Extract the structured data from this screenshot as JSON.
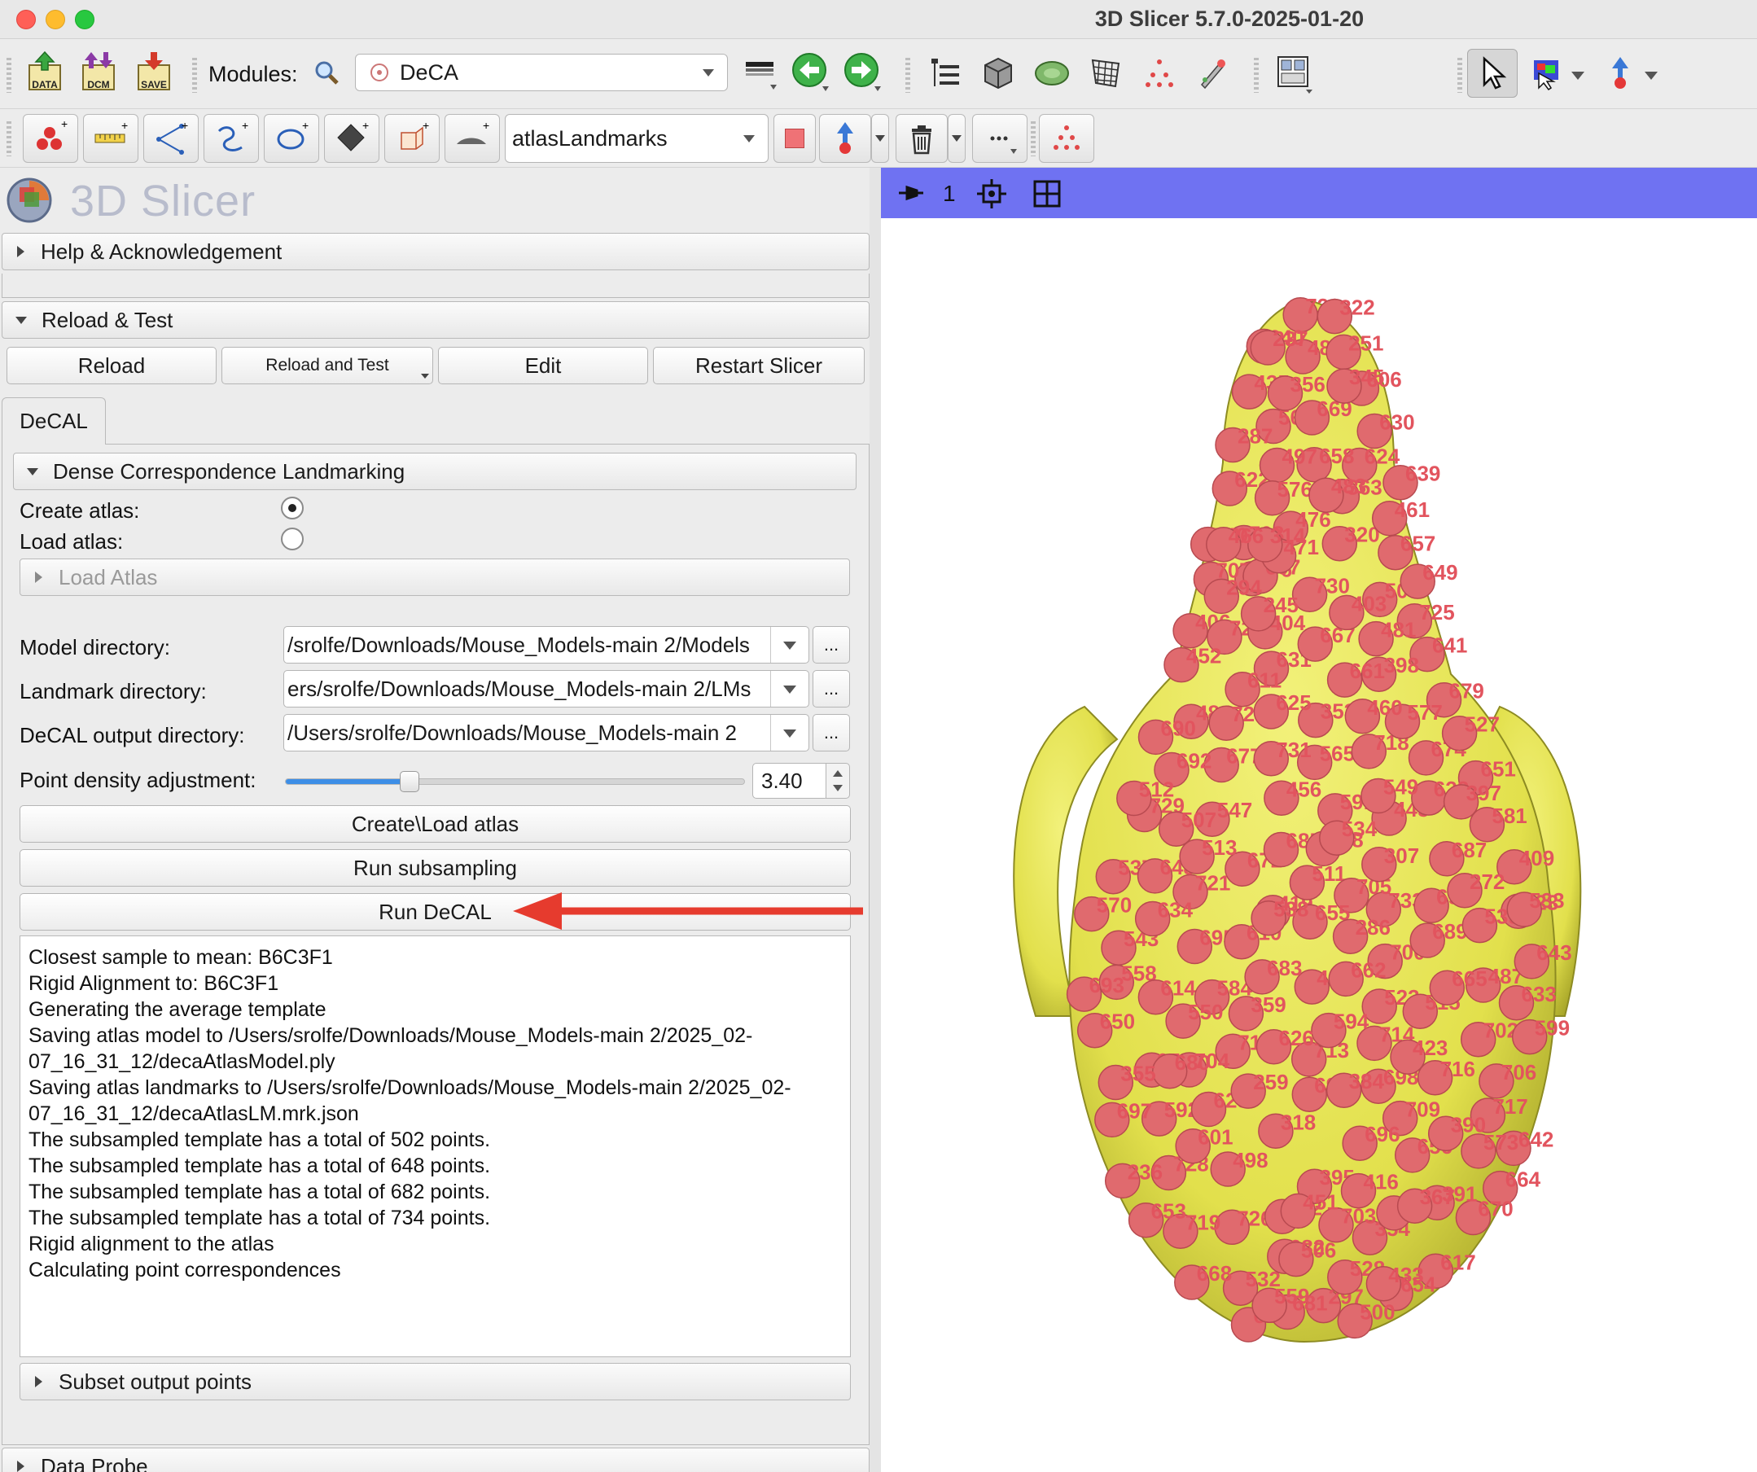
{
  "window": {
    "title": "3D Slicer 5.7.0-2025-01-20"
  },
  "toolbar": {
    "data_label": "DATA",
    "dcm_label": "DCM",
    "save_label": "SAVE",
    "modules_label": "Modules:",
    "module_selected": "DeCA",
    "markup_node": "atlasLandmarks"
  },
  "panel": {
    "logo_text": "3D Slicer",
    "help_section": "Help & Acknowledgement",
    "reload_section": "Reload & Test",
    "reload_button": "Reload",
    "reload_test_button": "Reload and Test",
    "edit_button": "Edit",
    "restart_button": "Restart Slicer",
    "tab_label": "DeCAL",
    "dense_section": "Dense Correspondence Landmarking",
    "create_atlas_label": "Create atlas:",
    "load_atlas_label": "Load atlas:",
    "load_atlas_section": "Load Atlas",
    "model_dir_label": "Model directory:",
    "model_dir_value": "/srolfe/Downloads/Mouse_Models-main 2/Models",
    "landmark_dir_label": "Landmark directory:",
    "landmark_dir_value": "ers/srolfe/Downloads/Mouse_Models-main 2/LMs",
    "output_dir_label": "DeCAL output directory:",
    "output_dir_value": "/Users/srolfe/Downloads/Mouse_Models-main 2",
    "dots": "...",
    "density_label": "Point density adjustment:",
    "density_value": "3.40",
    "density_fraction": 0.27,
    "create_load_button": "Create\\Load atlas",
    "subsampling_button": "Run subsampling",
    "run_decal_button": "Run DeCAL",
    "log_lines": [
      "Closest sample to mean: B6C3F1",
      "Rigid Alignment to: B6C3F1",
      "Generating the average template",
      "Saving atlas model to /Users/srolfe/Downloads/Mouse_Models-main 2/2025_02-07_16_31_12/decaAtlasModel.ply",
      "Saving atlas landmarks to /Users/srolfe/Downloads/Mouse_Models-main 2/2025_02-07_16_31_12/decaAtlasLM.mrk.json",
      "The subsampled template has a total of 502 points.",
      "The subsampled template has a total of 648 points.",
      "The subsampled template has a total of 682 points.",
      "The subsampled template has a total of 734 points.",
      "Rigid alignment to the atlas",
      "Calculating point correspondences"
    ],
    "subset_section": "Subset output points",
    "data_probe_section": "Data Probe"
  },
  "viewer": {
    "view_number": "1",
    "landmark_labels": [
      "591",
      "568",
      "565",
      "606",
      "419",
      "503",
      "558",
      "547",
      "614",
      "511",
      "622",
      "617",
      "532",
      "584",
      "639",
      "677",
      "672",
      "624",
      "631",
      "657",
      "698",
      "692",
      "480",
      "523",
      "674",
      "676",
      "675",
      "664",
      "537",
      "476",
      "515",
      "649",
      "722",
      "726",
      "487",
      "435",
      "687",
      "728",
      "729",
      "730",
      "592",
      "543",
      "484",
      "456",
      "322",
      "641",
      "714",
      "731",
      "685",
      "630",
      "492",
      "354",
      "651",
      "342",
      "445",
      "717",
      "409",
      "297",
      "683",
      "716",
      "315",
      "406",
      "363",
      "725",
      "703",
      "353",
      "719",
      "724",
      "236",
      "713",
      "320",
      "670",
      "679",
      "318",
      "723",
      "720",
      "709",
      "656",
      "678",
      "706",
      "696",
      "721",
      "733",
      "718",
      "654",
      "634",
      "398",
      "625",
      "669",
      "715",
      "705",
      "695",
      "287",
      "650",
      "694",
      "708",
      "668",
      "404",
      "251",
      "615",
      "667",
      "700",
      "702",
      "707",
      "693",
      "259",
      "570",
      "643",
      "395",
      "498",
      "594",
      "682",
      "697",
      "699",
      "611",
      "391",
      "452",
      "628",
      "658",
      "681",
      "704",
      "690",
      "559",
      "680",
      "689",
      "662",
      "640",
      "403",
      "500",
      "607",
      "642",
      "661",
      "655",
      "599",
      "540",
      "539",
      "665",
      "653",
      "633",
      "356",
      "573",
      "648",
      "626",
      "581",
      "497",
      "528",
      "359",
      "507",
      "625",
      "610",
      "423",
      "601",
      "286",
      "533",
      "576",
      "577",
      "534",
      "461",
      "245",
      "384",
      "460",
      "550",
      "527",
      "483",
      "513",
      "538",
      "390",
      "433",
      "307",
      "237",
      "397",
      "549",
      "512",
      "471",
      "506",
      "451",
      "345",
      "314",
      "481",
      "355",
      "466",
      "416",
      "367",
      "294",
      "272"
    ],
    "colors": {
      "mesh": "#e9e85a",
      "landmark": "#e06a6e",
      "label": "#e2545e",
      "header": "#6f72f2"
    }
  }
}
